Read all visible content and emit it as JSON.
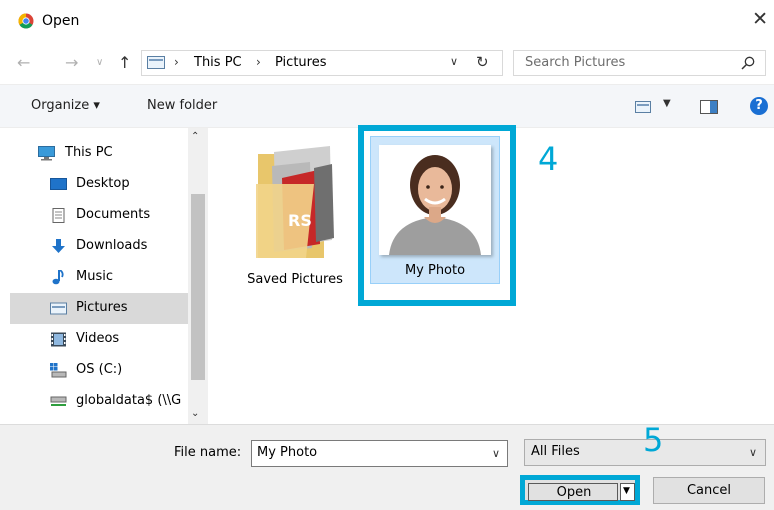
{
  "window": {
    "title": "Open",
    "close_glyph": "✕",
    "app_icon": "chrome-icon"
  },
  "nav": {
    "back_glyph": "←",
    "forward_glyph": "→",
    "recent_glyph": "∨",
    "up_glyph": "↑",
    "breadcrumb": [
      "This PC",
      "Pictures"
    ],
    "separator": "›",
    "dropdown_glyph": "∨",
    "refresh_glyph": "↻",
    "search_placeholder": "Search Pictures"
  },
  "toolbar": {
    "organize_label": "Organize ▾",
    "new_folder_label": "New folder",
    "view_drop_glyph": "▼",
    "help_label": "?"
  },
  "sidebar": {
    "items": [
      {
        "label": "This PC",
        "icon": "monitor-icon"
      },
      {
        "label": "Desktop",
        "icon": "desktop-icon"
      },
      {
        "label": "Documents",
        "icon": "documents-icon"
      },
      {
        "label": "Downloads",
        "icon": "download-icon"
      },
      {
        "label": "Music",
        "icon": "music-icon"
      },
      {
        "label": "Pictures",
        "icon": "pictures-icon",
        "selected": true
      },
      {
        "label": "Videos",
        "icon": "videos-icon"
      },
      {
        "label": "OS (C:)",
        "icon": "drive-icon"
      },
      {
        "label": "globaldata$ (\\\\G",
        "icon": "network-drive-icon"
      }
    ],
    "scroll_up_glyph": "⌃",
    "scroll_down_glyph": "⌄"
  },
  "files": {
    "items": [
      {
        "label": "Saved Pictures",
        "icon": "folder-icon"
      },
      {
        "label": "My Photo",
        "icon": "photo-thumbnail",
        "selected": true
      }
    ]
  },
  "annotations": {
    "step4": "4",
    "step5": "5",
    "highlight_color": "#00a8d6"
  },
  "footer": {
    "file_name_label": "File name:",
    "file_name_value": "My Photo",
    "file_name_drop_glyph": "∨",
    "file_type_value": "All Files",
    "file_type_drop_glyph": "∨",
    "open_label": "Open",
    "open_split_glyph": "▼",
    "cancel_label": "Cancel"
  }
}
